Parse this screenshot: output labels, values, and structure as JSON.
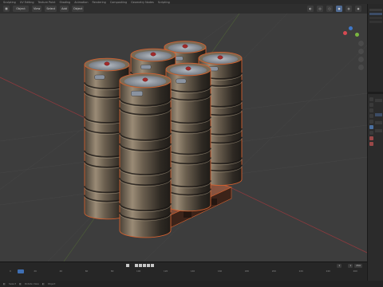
{
  "workspace_tabs": [
    "Sculpting",
    "UV Editing",
    "Texture Paint",
    "Shading",
    "Animation",
    "Rendering",
    "Compositing",
    "Geometry Nodes",
    "Scripting"
  ],
  "header": {
    "mode": "Object",
    "view": "View",
    "select": "Select",
    "add": "Add",
    "object": "Object",
    "viewport_shading": [
      "wire",
      "solid",
      "material",
      "rendered"
    ]
  },
  "timeline": {
    "current_frame": "1",
    "start": "1",
    "end": "250",
    "ruler": [
      "0",
      "20",
      "40",
      "60",
      "80",
      "100",
      "120",
      "140",
      "160",
      "180",
      "200",
      "220",
      "240",
      "260"
    ]
  },
  "status": {
    "left": "Select",
    "center": "Rotate View",
    "right": "Object"
  },
  "scene": {
    "object_type": "beer-keg-pallet",
    "keg_count": 6,
    "selection_color": "#d06030",
    "pallet_color": "#7a4a38",
    "background_color": "#3d3d3d"
  },
  "gizmo_colors": {
    "x": "#d84a52",
    "y": "#7ab640",
    "z": "#3f78c8"
  }
}
